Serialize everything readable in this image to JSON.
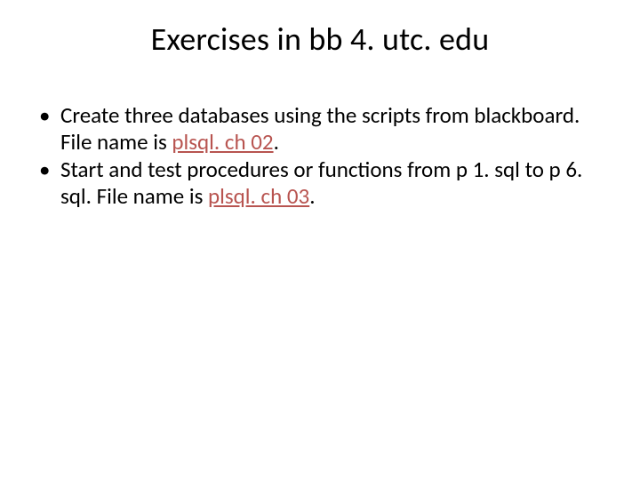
{
  "title": "Exercises in bb 4. utc. edu",
  "bullets": [
    {
      "pre": "Create three databases using the scripts from blackboard. File name is ",
      "u": "plsql. ch 02",
      "post": "."
    },
    {
      "pre": "Start and test procedures or functions from p 1. sql to p 6. sql.  File name is ",
      "u": "plsql. ch 03",
      "post": "."
    }
  ]
}
